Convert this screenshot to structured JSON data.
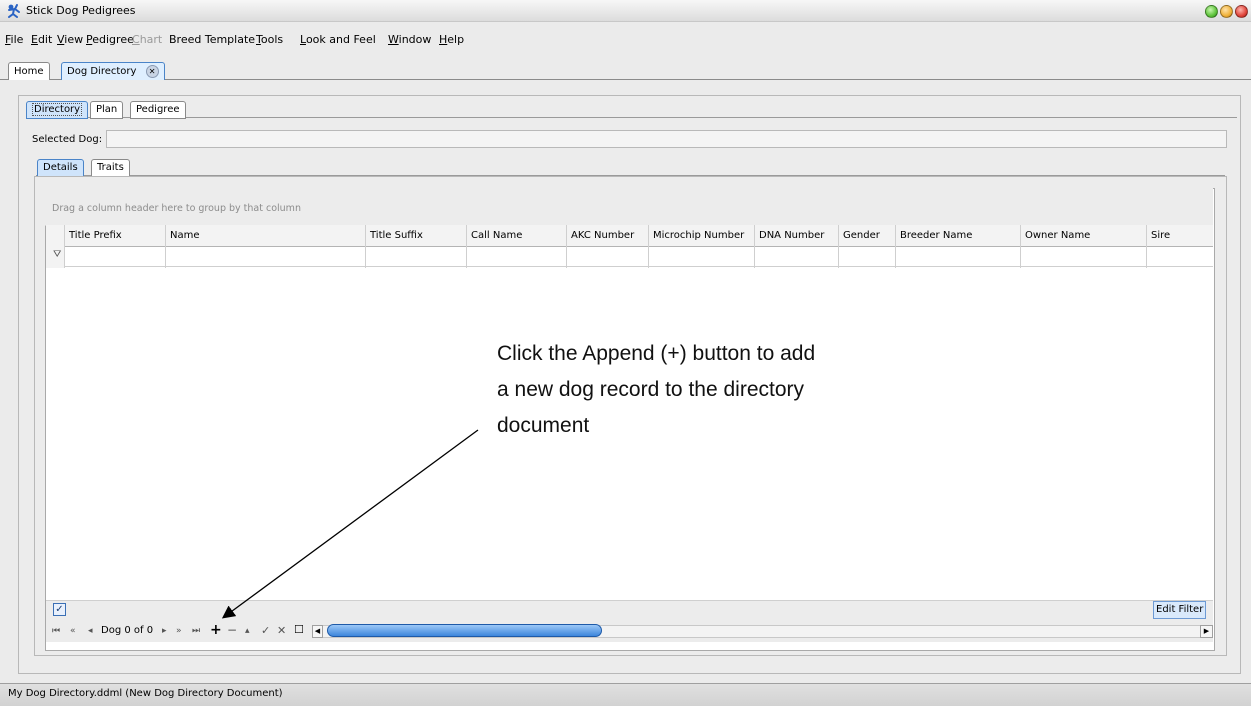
{
  "window": {
    "title": "Stick Dog Pedigrees"
  },
  "menubar": {
    "items": [
      {
        "label": "File",
        "underline": "F",
        "enabled": true
      },
      {
        "label": "Edit",
        "underline": "E",
        "enabled": true
      },
      {
        "label": "View",
        "underline": "V",
        "enabled": true
      },
      {
        "label": "Pedigree",
        "underline": "P",
        "enabled": true
      },
      {
        "label": "Chart",
        "underline": "C",
        "enabled": false
      },
      {
        "label": "Breed Template",
        "underline": "",
        "enabled": true
      },
      {
        "label": "Tools",
        "underline": "T",
        "enabled": true
      },
      {
        "label": "Look and Feel",
        "underline": "L",
        "enabled": true
      },
      {
        "label": "Window",
        "underline": "W",
        "enabled": true
      },
      {
        "label": "Help",
        "underline": "H",
        "enabled": true
      }
    ]
  },
  "doc_tabs": [
    {
      "label": "Home",
      "active": false,
      "closable": false
    },
    {
      "label": "Dog Directory",
      "active": true,
      "closable": true
    }
  ],
  "view_tabs": [
    {
      "label": "Directory",
      "active": true
    },
    {
      "label": "Plan",
      "active": false
    },
    {
      "label": "Pedigree",
      "active": false
    }
  ],
  "selected_dog": {
    "label": "Selected Dog:",
    "value": ""
  },
  "detail_tabs": [
    {
      "label": "Details",
      "active": true
    },
    {
      "label": "Traits",
      "active": false
    }
  ],
  "grid": {
    "group_hint": "Drag a column header here to group by that column",
    "columns": [
      "Title Prefix",
      "Name",
      "Title Suffix",
      "Call Name",
      "AKC Number",
      "Microchip Number",
      "DNA Number",
      "Gender",
      "Breeder Name",
      "Owner Name",
      "Sire"
    ],
    "rows": [],
    "filter_icon": "funnel-icon",
    "show_filter_checked": true,
    "edit_filter_label": "Edit Filter"
  },
  "navigator": {
    "first": "⏮",
    "prev_page": "«",
    "prev": "◂",
    "record_text": "Dog 0 of 0",
    "next": "▸",
    "next_page": "»",
    "last": "⏭",
    "append": "+",
    "delete": "−",
    "edit": "▴",
    "post": "✓",
    "cancel": "✕",
    "refresh": "☐"
  },
  "status": {
    "text": "My Dog Directory.ddml (New Dog Directory Document)"
  },
  "annotation": {
    "text": "Click the Append (+) button to add a new dog record to the directory document"
  },
  "colors": {
    "accent": "#4a84c8",
    "scroll_thumb": "#3d86dc",
    "win_green": "#5fc43c",
    "win_yellow": "#f0b23a",
    "win_red": "#e0453b"
  }
}
